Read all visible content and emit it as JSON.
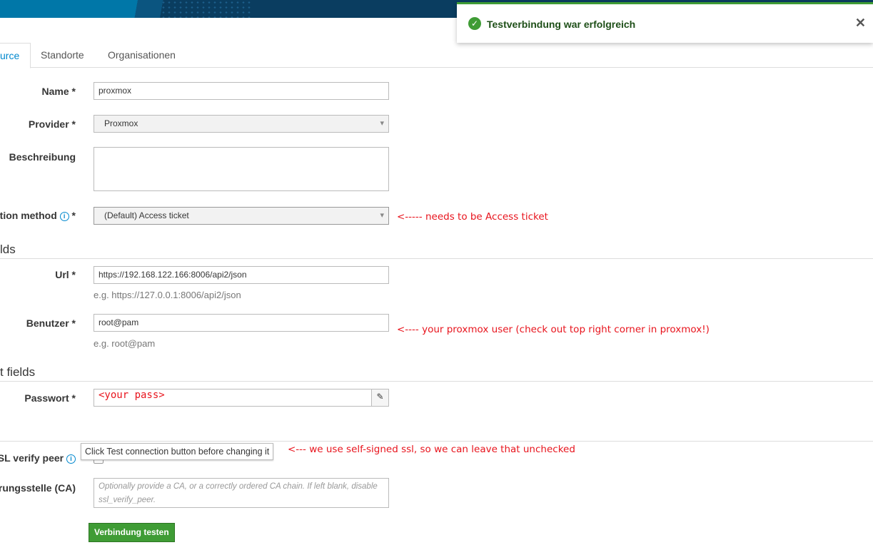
{
  "toast": {
    "message": "Testverbindung war erfolgreich",
    "status_color": "#3f9c35"
  },
  "tabs": [
    {
      "label": "urce",
      "active": true
    },
    {
      "label": "Standorte"
    },
    {
      "label": "Organisationen"
    }
  ],
  "form": {
    "name": {
      "label": "Name *",
      "value": "proxmox"
    },
    "provider": {
      "label": "Provider *",
      "value": "Proxmox"
    },
    "description": {
      "label": "Beschreibung",
      "value": ""
    },
    "auth_method": {
      "label": "tion method",
      "required": "*",
      "value": "(Default) Access ticket"
    },
    "section1": "lds",
    "url": {
      "label": "Url *",
      "value": "https://192.168.122.166:8006/api2/json",
      "help": "e.g. https://127.0.0.1:8006/api2/json"
    },
    "user": {
      "label": "Benutzer *",
      "value": "root@pam",
      "help": "e.g. root@pam"
    },
    "section2": "t fields",
    "password": {
      "label": "Passwort *",
      "value": "<your pass>"
    },
    "ssl": {
      "label": "SL verify peer",
      "tooltip": "Click Test connection button before changing it"
    },
    "ca": {
      "label": "rungsstelle (CA)",
      "placeholder": "Optionally provide a CA, or a correctly ordered CA chain. If left blank, disable ssl_verify_peer."
    },
    "test_button": "Verbindung testen"
  },
  "annotations": {
    "auth": "<----- needs to be Access ticket",
    "user": "<---- your proxmox user (check out top right corner in proxmox!)",
    "ssl": "<--- we use self-signed ssl, so we can leave that unchecked"
  }
}
